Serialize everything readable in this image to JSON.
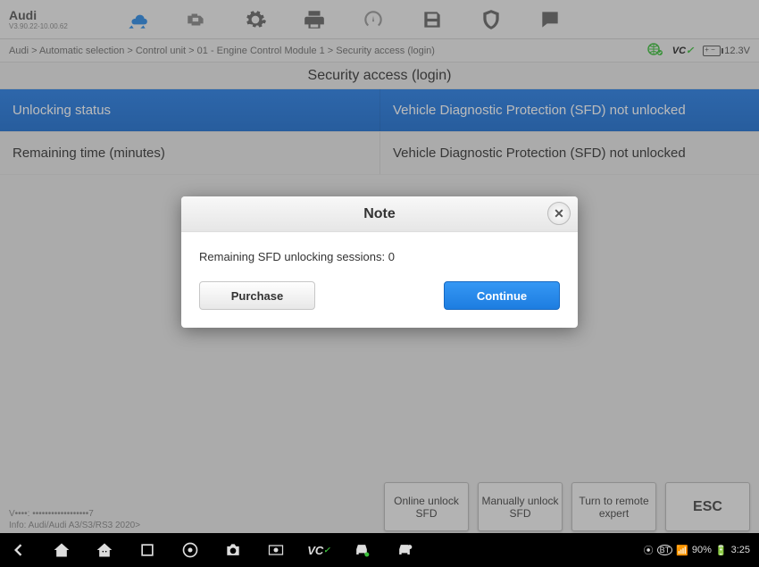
{
  "brand": {
    "name": "Audi",
    "version": "V3.90.22-10.00.62"
  },
  "breadcrumb": "Audi > Automatic selection > Control unit > 01 - Engine Control Module 1 > Security access (login)",
  "status": {
    "vci_label": "VC",
    "vci_ok": "✓",
    "battery": "12.3V"
  },
  "page_title": "Security access (login)",
  "table": {
    "header": {
      "left": "Unlocking status",
      "right": "Vehicle Diagnostic Protection (SFD) not unlocked"
    },
    "row1": {
      "left": "Remaining time (minutes)",
      "right": "Vehicle Diagnostic Protection (SFD) not unlocked"
    }
  },
  "info": {
    "line1": "V••••: ••••••••••••••••••7",
    "line2": "Info: Audi/Audi A3/S3/RS3 2020>"
  },
  "actions": {
    "online": "Online unlock SFD",
    "manual": "Manually unlock SFD",
    "remote": "Turn to remote expert",
    "esc": "ESC"
  },
  "modal": {
    "title": "Note",
    "message": "Remaining SFD unlocking sessions: 0",
    "purchase": "Purchase",
    "continue": "Continue"
  },
  "navbar": {
    "status_text": "90%",
    "time": "3:25"
  }
}
